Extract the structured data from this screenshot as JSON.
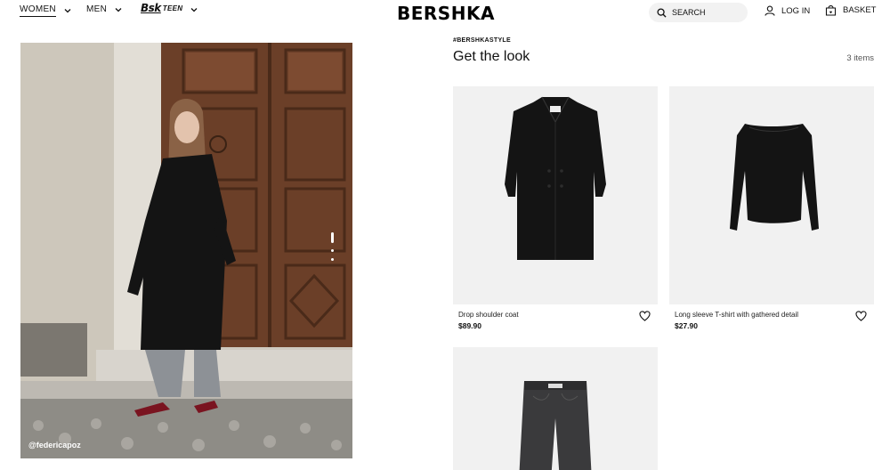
{
  "nav": {
    "women": "WOMEN",
    "men": "MEN",
    "teen_logo_main": "Bsk",
    "teen_logo_sub": "TEEN"
  },
  "brand": "BERSHKA",
  "search": {
    "label": "SEARCH",
    "icon": "search-icon"
  },
  "account": {
    "login": "LOG IN",
    "basket": "BASKET"
  },
  "hero": {
    "credit": "@federicapoz",
    "slides": 3,
    "active_slide": 1
  },
  "look": {
    "hashtag": "#BERSHKASTYLE",
    "title": "Get the look",
    "count": "3 items",
    "products": [
      {
        "name": "Drop shoulder coat",
        "price": "$89.90"
      },
      {
        "name": "Long sleeve T-shirt with gathered detail",
        "price": "$27.90"
      },
      {
        "name": "",
        "price": ""
      }
    ]
  },
  "colors": {
    "text": "#111111",
    "search_bg": "#f2f2f2",
    "card_bg": "#f1f1f1"
  }
}
